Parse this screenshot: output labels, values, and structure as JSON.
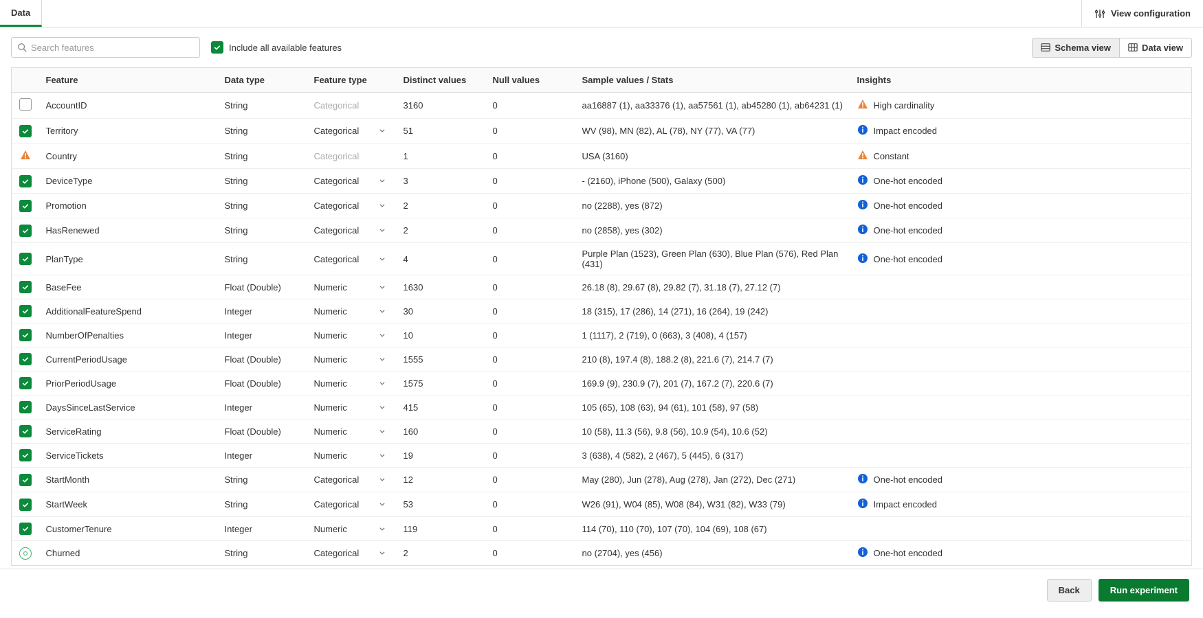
{
  "tabs": {
    "data": "Data"
  },
  "header": {
    "view_config": "View configuration"
  },
  "search": {
    "placeholder": "Search features"
  },
  "include_all": {
    "label": "Include all available features",
    "checked": true
  },
  "view_toggle": {
    "schema": "Schema view",
    "data": "Data view"
  },
  "columns": {
    "feature": "Feature",
    "data_type": "Data type",
    "feature_type": "Feature type",
    "distinct": "Distinct values",
    "nulls": "Null values",
    "sample": "Sample values / Stats",
    "insights": "Insights"
  },
  "rows": [
    {
      "sel": "empty",
      "feature": "AccountID",
      "dtype": "String",
      "ftype": "Categorical",
      "ftype_disabled": true,
      "distinct": "3160",
      "nulls": "0",
      "sample": "aa16887 (1), aa33376 (1), aa57561 (1), ab45280 (1), ab64231 (1)",
      "insight_icon": "warn",
      "insight": "High cardinality"
    },
    {
      "sel": "checked",
      "feature": "Territory",
      "dtype": "String",
      "ftype": "Categorical",
      "ftype_disabled": false,
      "distinct": "51",
      "nulls": "0",
      "sample": "WV (98), MN (82), AL (78), NY (77), VA (77)",
      "insight_icon": "info",
      "insight": "Impact encoded"
    },
    {
      "sel": "warn",
      "feature": "Country",
      "dtype": "String",
      "ftype": "Categorical",
      "ftype_disabled": true,
      "distinct": "1",
      "nulls": "0",
      "sample": "USA (3160)",
      "insight_icon": "warn",
      "insight": "Constant"
    },
    {
      "sel": "checked",
      "feature": "DeviceType",
      "dtype": "String",
      "ftype": "Categorical",
      "ftype_disabled": false,
      "distinct": "3",
      "nulls": "0",
      "sample": "- (2160), iPhone (500), Galaxy (500)",
      "insight_icon": "info",
      "insight": "One-hot encoded"
    },
    {
      "sel": "checked",
      "feature": "Promotion",
      "dtype": "String",
      "ftype": "Categorical",
      "ftype_disabled": false,
      "distinct": "2",
      "nulls": "0",
      "sample": "no (2288), yes (872)",
      "insight_icon": "info",
      "insight": "One-hot encoded"
    },
    {
      "sel": "checked",
      "feature": "HasRenewed",
      "dtype": "String",
      "ftype": "Categorical",
      "ftype_disabled": false,
      "distinct": "2",
      "nulls": "0",
      "sample": "no (2858), yes (302)",
      "insight_icon": "info",
      "insight": "One-hot encoded"
    },
    {
      "sel": "checked",
      "feature": "PlanType",
      "dtype": "String",
      "ftype": "Categorical",
      "ftype_disabled": false,
      "distinct": "4",
      "nulls": "0",
      "sample": "Purple Plan (1523), Green Plan (630), Blue Plan (576), Red Plan (431)",
      "insight_icon": "info",
      "insight": "One-hot encoded"
    },
    {
      "sel": "checked",
      "feature": "BaseFee",
      "dtype": "Float (Double)",
      "ftype": "Numeric",
      "ftype_disabled": false,
      "distinct": "1630",
      "nulls": "0",
      "sample": "26.18 (8), 29.67 (8), 29.82 (7), 31.18 (7), 27.12 (7)",
      "insight_icon": "",
      "insight": ""
    },
    {
      "sel": "checked",
      "feature": "AdditionalFeatureSpend",
      "dtype": "Integer",
      "ftype": "Numeric",
      "ftype_disabled": false,
      "distinct": "30",
      "nulls": "0",
      "sample": "18 (315), 17 (286), 14 (271), 16 (264), 19 (242)",
      "insight_icon": "",
      "insight": ""
    },
    {
      "sel": "checked",
      "feature": "NumberOfPenalties",
      "dtype": "Integer",
      "ftype": "Numeric",
      "ftype_disabled": false,
      "distinct": "10",
      "nulls": "0",
      "sample": "1 (1117), 2 (719), 0 (663), 3 (408), 4 (157)",
      "insight_icon": "",
      "insight": ""
    },
    {
      "sel": "checked",
      "feature": "CurrentPeriodUsage",
      "dtype": "Float (Double)",
      "ftype": "Numeric",
      "ftype_disabled": false,
      "distinct": "1555",
      "nulls": "0",
      "sample": "210 (8), 197.4 (8), 188.2 (8), 221.6 (7), 214.7 (7)",
      "insight_icon": "",
      "insight": ""
    },
    {
      "sel": "checked",
      "feature": "PriorPeriodUsage",
      "dtype": "Float (Double)",
      "ftype": "Numeric",
      "ftype_disabled": false,
      "distinct": "1575",
      "nulls": "0",
      "sample": "169.9 (9), 230.9 (7), 201 (7), 167.2 (7), 220.6 (7)",
      "insight_icon": "",
      "insight": ""
    },
    {
      "sel": "checked",
      "feature": "DaysSinceLastService",
      "dtype": "Integer",
      "ftype": "Numeric",
      "ftype_disabled": false,
      "distinct": "415",
      "nulls": "0",
      "sample": "105 (65), 108 (63), 94 (61), 101 (58), 97 (58)",
      "insight_icon": "",
      "insight": ""
    },
    {
      "sel": "checked",
      "feature": "ServiceRating",
      "dtype": "Float (Double)",
      "ftype": "Numeric",
      "ftype_disabled": false,
      "distinct": "160",
      "nulls": "0",
      "sample": "10 (58), 11.3 (56), 9.8 (56), 10.9 (54), 10.6 (52)",
      "insight_icon": "",
      "insight": ""
    },
    {
      "sel": "checked",
      "feature": "ServiceTickets",
      "dtype": "Integer",
      "ftype": "Numeric",
      "ftype_disabled": false,
      "distinct": "19",
      "nulls": "0",
      "sample": "3 (638), 4 (582), 2 (467), 5 (445), 6 (317)",
      "insight_icon": "",
      "insight": ""
    },
    {
      "sel": "checked",
      "feature": "StartMonth",
      "dtype": "String",
      "ftype": "Categorical",
      "ftype_disabled": false,
      "distinct": "12",
      "nulls": "0",
      "sample": "May (280), Jun (278), Aug (278), Jan (272), Dec (271)",
      "insight_icon": "info",
      "insight": "One-hot encoded"
    },
    {
      "sel": "checked",
      "feature": "StartWeek",
      "dtype": "String",
      "ftype": "Categorical",
      "ftype_disabled": false,
      "distinct": "53",
      "nulls": "0",
      "sample": "W26 (91), W04 (85), W08 (84), W31 (82), W33 (79)",
      "insight_icon": "info",
      "insight": "Impact encoded"
    },
    {
      "sel": "checked",
      "feature": "CustomerTenure",
      "dtype": "Integer",
      "ftype": "Numeric",
      "ftype_disabled": false,
      "distinct": "119",
      "nulls": "0",
      "sample": "114 (70), 110 (70), 107 (70), 104 (69), 108 (67)",
      "insight_icon": "",
      "insight": ""
    },
    {
      "sel": "target",
      "feature": "Churned",
      "dtype": "String",
      "ftype": "Categorical",
      "ftype_disabled": false,
      "distinct": "2",
      "nulls": "0",
      "sample": "no (2704), yes (456)",
      "insight_icon": "info",
      "insight": "One-hot encoded"
    }
  ],
  "footer": {
    "back": "Back",
    "run": "Run experiment"
  }
}
